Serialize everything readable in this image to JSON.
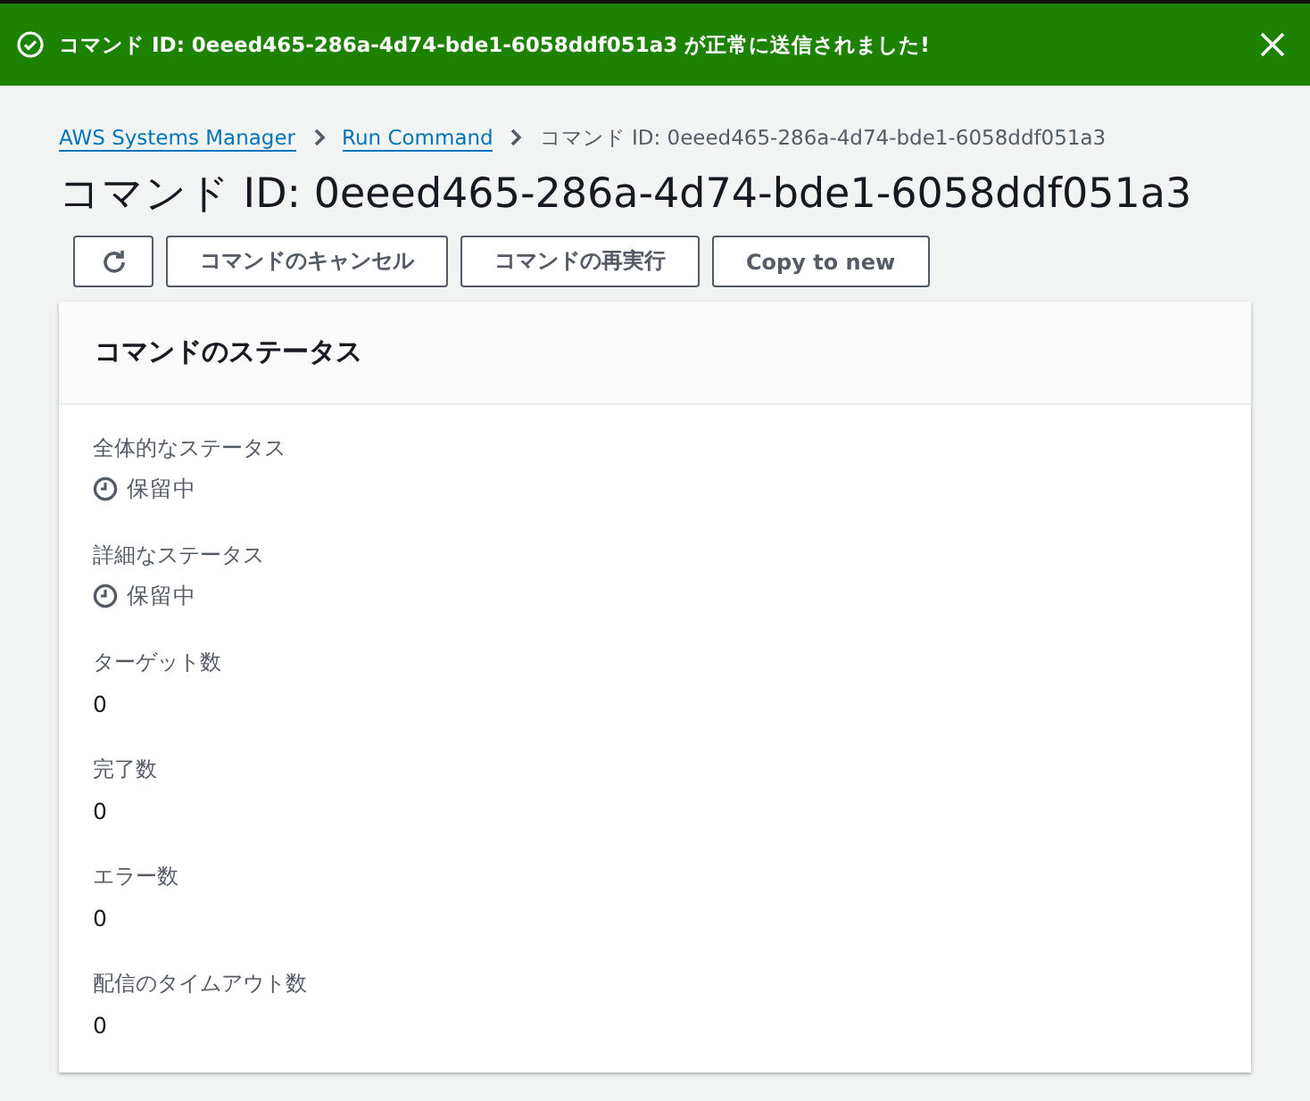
{
  "flash": {
    "message": "コマンド ID: 0eeed465-286a-4d74-bde1-6058ddf051a3 が正常に送信されました!"
  },
  "breadcrumbs": [
    {
      "label": "AWS Systems Manager",
      "kind": "link"
    },
    {
      "label": "Run Command",
      "kind": "link"
    },
    {
      "label": "コマンド ID: 0eeed465-286a-4d74-bde1-6058ddf051a3",
      "kind": "current"
    }
  ],
  "title": "コマンド ID: 0eeed465-286a-4d74-bde1-6058ddf051a3",
  "buttons": [
    "コマンドのキャンセル",
    "コマンドの再実行",
    "Copy to new"
  ],
  "panel": {
    "title": "コマンドのステータス",
    "fields": [
      {
        "label": "全体的なステータス",
        "value": "保留中",
        "kind": "status"
      },
      {
        "label": "詳細なステータス",
        "value": "保留中",
        "kind": "status"
      },
      {
        "label": "ターゲット数",
        "value": "0",
        "kind": "number"
      },
      {
        "label": "完了数",
        "value": "0",
        "kind": "number"
      },
      {
        "label": "エラー数",
        "value": "0",
        "kind": "number"
      },
      {
        "label": "配信のタイムアウト数",
        "value": "0",
        "kind": "number"
      }
    ]
  }
}
